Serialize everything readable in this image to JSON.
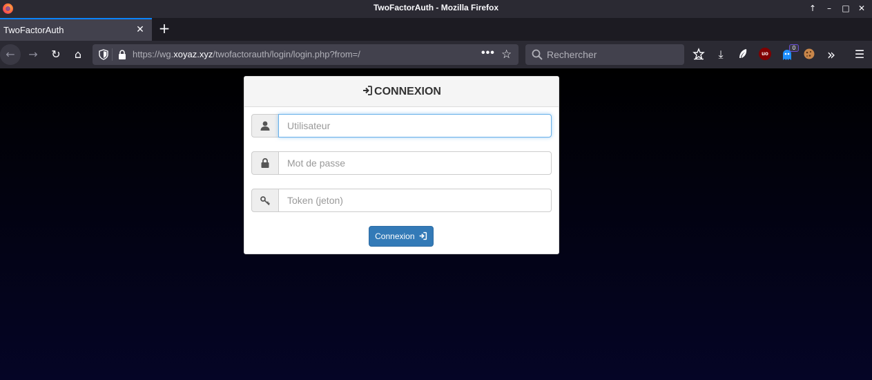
{
  "window": {
    "title": "TwoFactorAuth - Mozilla Firefox",
    "minimize_glyph": "–",
    "maximize_glyph": "□",
    "close_glyph": "✕",
    "restore_glyph": "↑"
  },
  "tabs": [
    {
      "label": "TwoFactorAuth",
      "close_glyph": "✕"
    }
  ],
  "newtab_glyph": "+",
  "nav": {
    "back_glyph": "←",
    "forward_glyph": "→",
    "reload_glyph": "↻",
    "home_glyph": "⌂",
    "url_prefix": "https://wg.",
    "url_host": "xoyaz.xyz",
    "url_path": "/twofactorauth/login/login.php?from=/",
    "more_glyph": "•••",
    "bookmark_glyph": "☆",
    "search_placeholder": "Rechercher",
    "overflow_glyph": "»",
    "menu_glyph": "☰",
    "download_glyph": "⤓",
    "ublock_label": "uo",
    "badge_count": "0"
  },
  "login": {
    "heading": "CONNEXION",
    "username_placeholder": "Utilisateur",
    "password_placeholder": "Mot de passe",
    "token_placeholder": "Token (jeton)",
    "submit_label": "Connexion"
  },
  "colors": {
    "accent": "#0a84ff",
    "primary_button": "#337ab7",
    "focus_border": "#66afe9"
  }
}
